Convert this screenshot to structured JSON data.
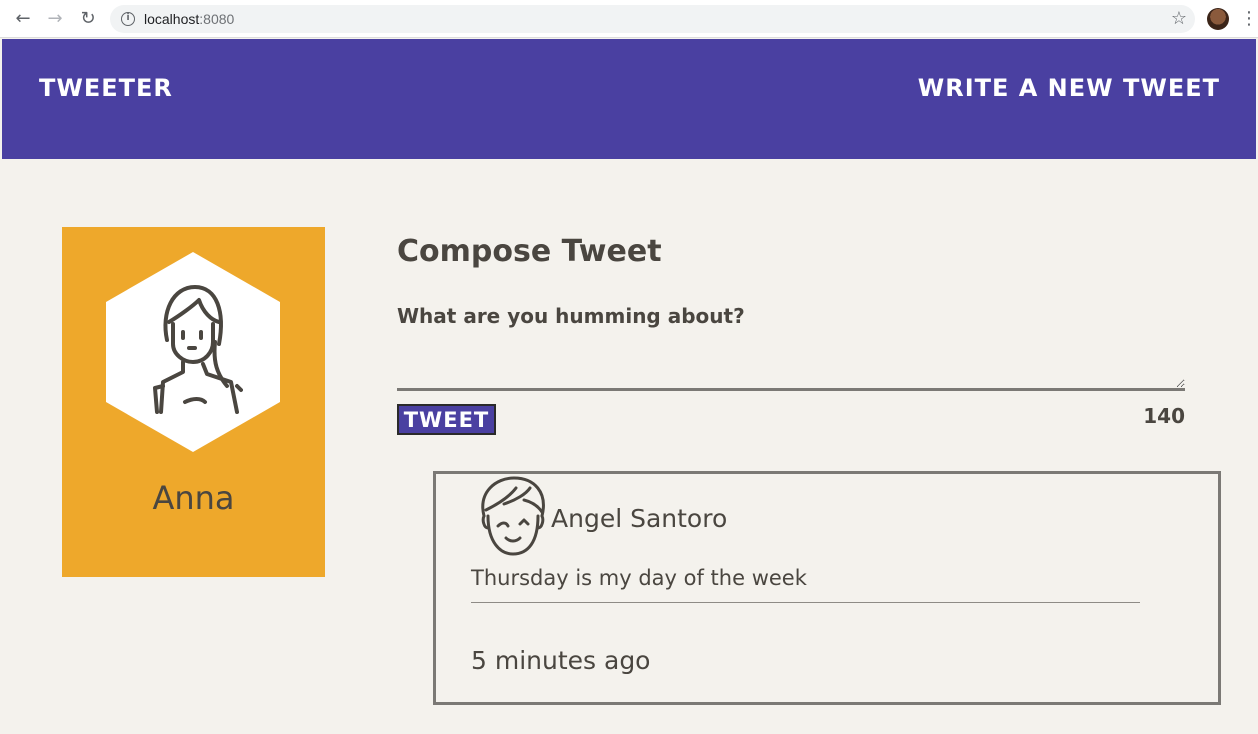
{
  "browser": {
    "url_host": "localhost",
    "url_port": ":8080",
    "icons": {
      "back": "arrow-left-icon",
      "forward": "arrow-right-icon",
      "reload": "reload-icon",
      "info": "info-icon",
      "bookmark": "star-icon",
      "menu": "kebab-menu-icon"
    }
  },
  "header": {
    "brand": "Tweeter",
    "write_link": "Write a new tweet",
    "background": "#4a40a1"
  },
  "profile": {
    "name": "Anna",
    "card_color": "#eea82b",
    "avatar_icon": "woman-avatar-icon"
  },
  "compose": {
    "title": "Compose Tweet",
    "label": "What are you humming about?",
    "input_value": "",
    "button_label": "Tweet",
    "counter": "140"
  },
  "tweets": [
    {
      "author": "Angel Santoro",
      "text": "Thursday is my day of the week",
      "time": "5 minutes ago",
      "avatar_icon": "winking-boy-avatar-icon"
    }
  ]
}
